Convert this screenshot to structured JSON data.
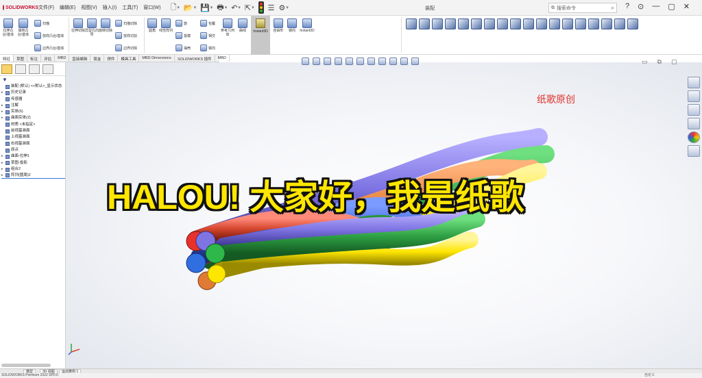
{
  "app": {
    "name": "SOLIDWORKS",
    "doc_title": "装配"
  },
  "menu": [
    "文件(F)",
    "编辑(E)",
    "视图(V)",
    "插入(I)",
    "工具(T)",
    "窗口(W)"
  ],
  "search": {
    "placeholder": "搜索命令"
  },
  "window_controls": [
    "?",
    "⊙",
    "—",
    "▢",
    "✕"
  ],
  "ribbon": {
    "tools_large": [
      "拉伸凸台/基体",
      "旋转凸台/基体",
      "拉伸切除",
      "异型孔向导",
      "旋转切除",
      "圆角",
      "线性阵列",
      "筋",
      "参考几何体",
      "曲线",
      "Instant3D",
      "包覆",
      "相交",
      "自由形",
      "镜向"
    ],
    "tools_small": [
      "扫描",
      "放样凸台/基体",
      "边界凸台/基体",
      "扫描切除",
      "放样切割",
      "边界切除",
      "拔模",
      "抽壳",
      "镜向"
    ],
    "instant3d": "Instant3D"
  },
  "tabs": [
    "特征",
    "草图",
    "标注",
    "评估",
    "MBD",
    "直接编辑",
    "钣金",
    "焊件",
    "模具工具",
    "MBD Dimensions",
    "SOLIDWORKS 插件",
    "MBD"
  ],
  "tree": [
    {
      "label": "装配 (默认) <<默认>_显示状态",
      "expander": "",
      "highlight": false
    },
    {
      "label": "历史记录",
      "expander": "▸",
      "highlight": false
    },
    {
      "label": "传感器",
      "expander": "",
      "highlight": false
    },
    {
      "label": "注解",
      "expander": "▸",
      "highlight": false
    },
    {
      "label": "实体(6)",
      "expander": "▸",
      "highlight": false
    },
    {
      "label": "曲面实体(2)",
      "expander": "▸",
      "highlight": false
    },
    {
      "label": "材质 <未指定>",
      "expander": "",
      "highlight": false
    },
    {
      "label": "前视基准面",
      "expander": "",
      "highlight": false
    },
    {
      "label": "上视基准面",
      "expander": "",
      "highlight": false
    },
    {
      "label": "右视基准面",
      "expander": "",
      "highlight": false
    },
    {
      "label": "原点",
      "expander": "",
      "highlight": false
    },
    {
      "label": "曲面-拉伸1",
      "expander": "▸",
      "highlight": false
    },
    {
      "label": "草图-投影",
      "expander": "▸",
      "highlight": false
    },
    {
      "label": "组合2",
      "expander": "▸",
      "highlight": false
    },
    {
      "label": "阵列(圆周)2",
      "expander": "▸",
      "highlight": true
    }
  ],
  "viewport": {
    "watermark": "纸歌原创",
    "caption": "HALOU! 大家好，我是纸歌"
  },
  "rope": {
    "strand_colors": [
      "#3b5fd3",
      "#2ea043",
      "#ffe600",
      "#d4462d",
      "#e07a35",
      "#7e74e3"
    ]
  },
  "bottom_tabs": [
    "模型",
    "3D 视图",
    "运动算例 1"
  ],
  "status": {
    "left": "SOLIDWORKS Premium 2022 SP0.0",
    "right": "自定义"
  }
}
